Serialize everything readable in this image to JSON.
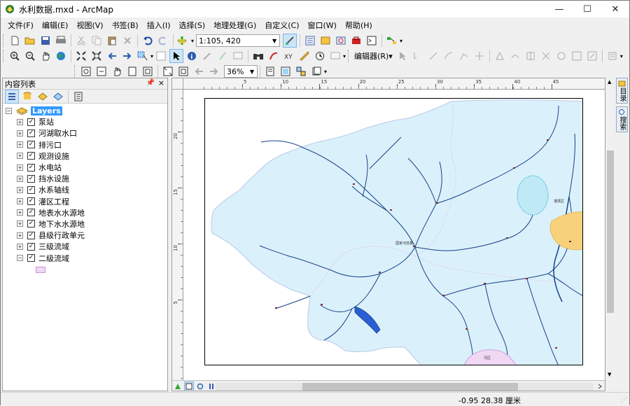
{
  "window": {
    "title": "水利数据.mxd - ArcMap",
    "min": "—",
    "max": "☐",
    "close": "✕"
  },
  "menu": [
    "文件(F)",
    "编辑(E)",
    "视图(V)",
    "书签(B)",
    "插入(I)",
    "选择(S)",
    "地理处理(G)",
    "自定义(C)",
    "窗口(W)",
    "帮助(H)"
  ],
  "toolbar": {
    "scale": "1:105, 420",
    "editor_label": "编辑器(R)▾",
    "zoom": "36%"
  },
  "toc": {
    "title": "内容列表",
    "pin": "📌",
    "close": "×",
    "root": "Layers",
    "layers": [
      "泵站",
      "河湖取水口",
      "排污口",
      "观测设施",
      "水电站",
      "挡水设施",
      "水系轴线",
      "灌区工程",
      "地表水水源地",
      "地下水水源地",
      "县级行政单元",
      "三级流域",
      "二级流域"
    ]
  },
  "ruler": {
    "h": [
      "5",
      "10",
      "15",
      "20",
      "25",
      "30",
      "35",
      "40",
      "45"
    ],
    "v": [
      "20",
      "15",
      "10",
      "5"
    ]
  },
  "map_labels": [
    "灌溉区",
    "国家河流量",
    "汛区"
  ],
  "side_tabs": [
    "目录",
    "搜索"
  ],
  "status": {
    "coords": "-0.95  28.38 厘米"
  },
  "colors": {
    "water": "#daf1fb",
    "river": "#1a3f8a",
    "accent": "#3399ff"
  }
}
